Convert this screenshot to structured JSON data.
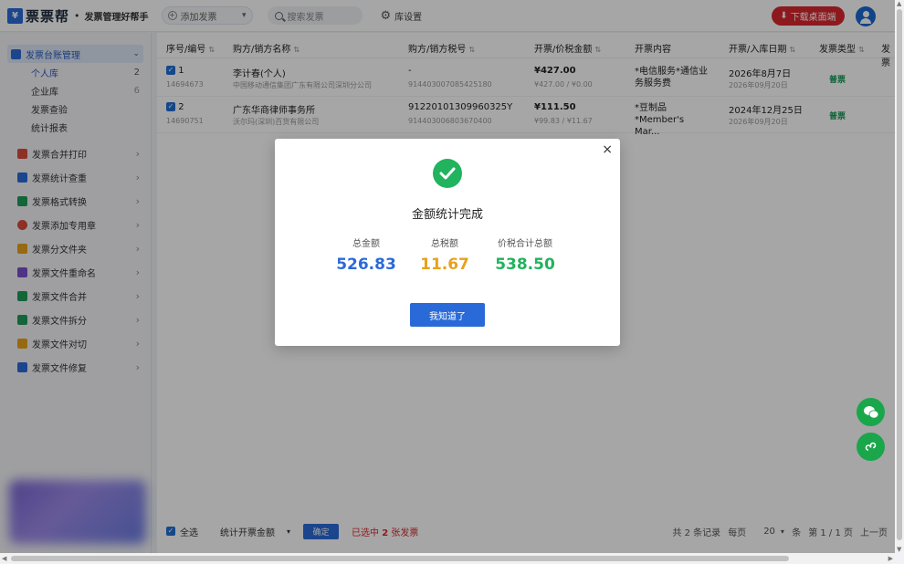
{
  "app": {
    "logo_mark": "¥",
    "logo_text": "票票帮",
    "logo_dot": "•",
    "tagline": "发票管理好帮手"
  },
  "header": {
    "add_invoice_label": "添加发票",
    "search_placeholder": "搜索发票",
    "settings_label": "库设置",
    "download_label": "下载桌面端"
  },
  "sidebar": {
    "group": {
      "label": "发票台账管理",
      "subitems": [
        {
          "label": "个人库",
          "count": "2"
        },
        {
          "label": "企业库",
          "count": "6"
        },
        {
          "label": "发票查验",
          "count": ""
        },
        {
          "label": "统计报表",
          "count": ""
        }
      ]
    },
    "items": [
      {
        "label": "发票合并打印",
        "color": "#d94a3a"
      },
      {
        "label": "发票统计查重",
        "color": "#2a6ad8"
      },
      {
        "label": "发票格式转换",
        "color": "#1e9c5a"
      },
      {
        "label": "发票添加专用章",
        "color": "#d94a3a"
      },
      {
        "label": "发票分文件夹",
        "color": "#e8a21a"
      },
      {
        "label": "发票文件重命名",
        "color": "#7a4fd0"
      },
      {
        "label": "发票文件合并",
        "color": "#1e9c5a"
      },
      {
        "label": "发票文件拆分",
        "color": "#1e9c5a"
      },
      {
        "label": "发票文件对切",
        "color": "#e8a21a"
      },
      {
        "label": "发票文件修复",
        "color": "#2a6ad8"
      }
    ]
  },
  "table": {
    "headers": [
      "序号/编号",
      "购方/销方名称",
      "购方/销方税号",
      "开票/价税金额",
      "开票内容",
      "开票/入库日期",
      "发票类型",
      "发票"
    ],
    "rows": [
      {
        "index": "1",
        "code": "14694673",
        "buyer": "李计春(个人)",
        "seller": "中国移动通信集团广东有限公司深圳分公司",
        "buyer_tax": "-",
        "seller_tax": "914403007085425180",
        "amount": "¥427.00",
        "amount_detail": "¥427.00 / ¥0.00",
        "content": "*电信服务*通信业务服务费",
        "issue_date": "2026年8月7日",
        "store_date": "2026年09月20日",
        "type": "普票"
      },
      {
        "index": "2",
        "code": "14690751",
        "buyer": "广东华商律师事务所",
        "seller": "沃尔玛(深圳)百货有限公司",
        "buyer_tax": "91220101309960325Y",
        "seller_tax": "914403006803670400",
        "amount": "¥111.50",
        "amount_detail": "¥99.83 / ¥11.67",
        "content": "*豆制品*Member's Mar...",
        "issue_date": "2024年12月25日",
        "store_date": "2026年09月20日",
        "type": "普票"
      }
    ]
  },
  "footer": {
    "select_all": "全选",
    "stat_option": "统计开票金额",
    "confirm": "确定",
    "selected_prefix": "已选中",
    "selected_count": "2",
    "selected_suffix": "张发票",
    "total_records": "共 2 条记录",
    "per_page_label": "每页",
    "per_page": "20",
    "per_page_unit": "条",
    "page_info": "第 1 / 1 页",
    "prev_page": "上一页"
  },
  "modal": {
    "title": "金额统计完成",
    "close": "×",
    "stats": [
      {
        "label": "总金额",
        "value": "526.83",
        "color": "#2a6ad8"
      },
      {
        "label": "总税额",
        "value": "11.67",
        "color": "#e8a21a"
      },
      {
        "label": "价税合计总额",
        "value": "538.50",
        "color": "#21b35d"
      }
    ],
    "ok": "我知道了"
  }
}
